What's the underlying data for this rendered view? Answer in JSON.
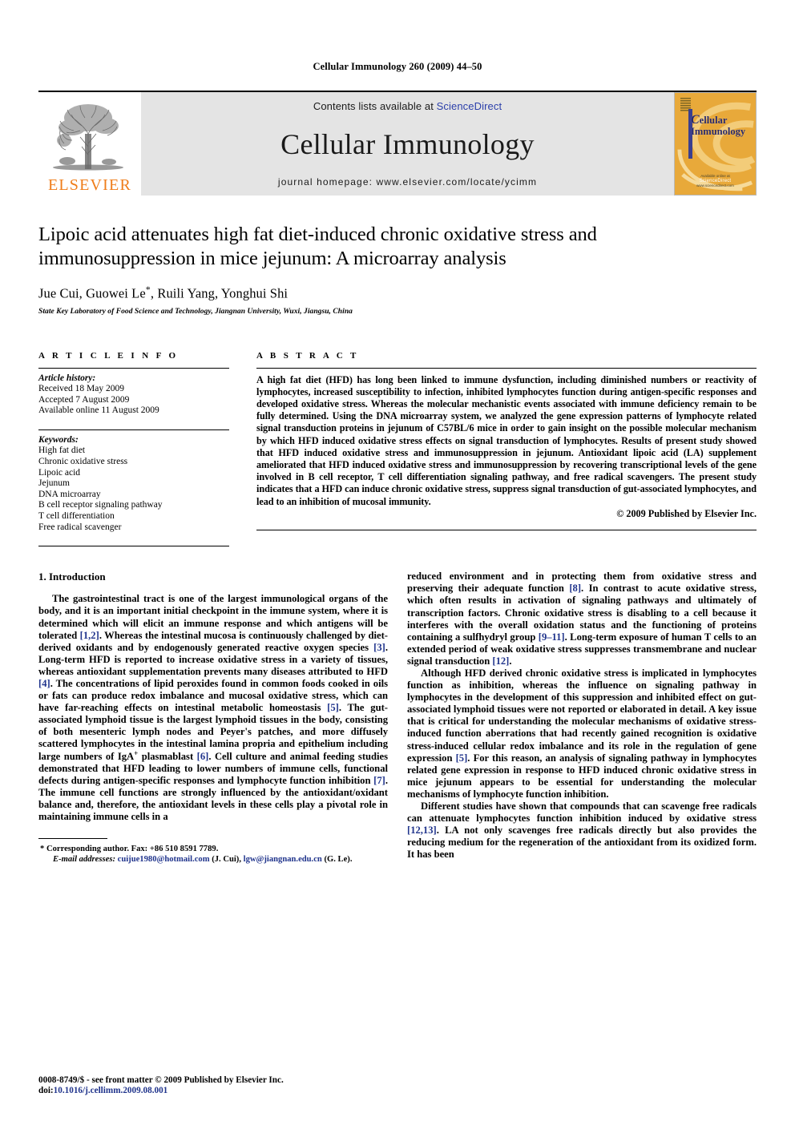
{
  "running_head": "Cellular Immunology 260 (2009) 44–50",
  "masthead": {
    "publisher_name": "ELSEVIER",
    "contents_prefix": "Contents lists available at ",
    "contents_link": "ScienceDirect",
    "journal_title": "Cellular Immunology",
    "homepage_line": "journal homepage: www.elsevier.com/locate/ycimm",
    "cover": {
      "title_first": "C",
      "title_rest_line1": "ellular",
      "title_line2": "Immunology",
      "footer_line1": "Available online at",
      "footer_brand": "ScienceDirect",
      "footer_line2": "www.sciencedirect.com"
    }
  },
  "article": {
    "title": "Lipoic acid attenuates high fat diet-induced chronic oxidative stress and immunosuppression in mice jejunum: A microarray analysis",
    "authors": "Jue Cui, Guowei Le",
    "authors_rest": ", Ruili Yang, Yonghui Shi",
    "corresponding_marker": "*",
    "affiliation": "State Key Laboratory of Food Science and Technology, Jiangnan University, Wuxi, Jiangsu, China"
  },
  "article_info": {
    "heading": "A R T I C L E     I N F O",
    "history_label": "Article history:",
    "history": [
      "Received 18 May 2009",
      "Accepted 7 August 2009",
      "Available online 11 August 2009"
    ],
    "keywords_label": "Keywords:",
    "keywords": [
      "High fat diet",
      "Chronic oxidative stress",
      "Lipoic acid",
      "Jejunum",
      "DNA microarray",
      "B cell receptor signaling pathway",
      "T cell differentiation",
      "Free radical scavenger"
    ]
  },
  "abstract": {
    "heading": "A B S T R A C T",
    "text": "A high fat diet (HFD) has long been linked to immune dysfunction, including diminished numbers or reactivity of lymphocytes, increased susceptibility to infection, inhibited lymphocytes function during antigen-specific responses and developed oxidative stress. Whereas the molecular mechanistic events associated with immune deficiency remain to be fully determined. Using the DNA microarray system, we analyzed the gene expression patterns of lymphocyte related signal transduction proteins in jejunum of C57BL/6 mice in order to gain insight on the possible molecular mechanism by which HFD induced oxidative stress effects on signal transduction of lymphocytes. Results of present study showed that HFD induced oxidative stress and immunosuppression in jejunum. Antioxidant lipoic acid (LA) supplement ameliorated that HFD induced oxidative stress and immunosuppression by recovering transcriptional levels of the gene involved in B cell receptor, T cell differentiation signaling pathway, and free radical scavengers. The present study indicates that a HFD can induce chronic oxidative stress, suppress signal transduction of gut-associated lymphocytes, and lead to an inhibition of mucosal immunity.",
    "copyright": "© 2009 Published by Elsevier Inc."
  },
  "introduction": {
    "heading": "1. Introduction",
    "left_paragraph_1_a": "The gastrointestinal tract is one of the largest immunological organs of the body, and it is an important initial checkpoint in the immune system, where it is determined which will elicit an immune response and which antigens will be tolerated ",
    "ref_1_2": "[1,2]",
    "left_paragraph_1_b": ". Whereas the intestinal mucosa is continuously challenged by diet-derived oxidants and by endogenously generated reactive oxygen species ",
    "ref_3": "[3]",
    "left_paragraph_1_c": ". Long-term HFD is reported to increase oxidative stress in a variety of tissues, whereas antioxidant supplementation prevents many diseases attributed to HFD ",
    "ref_4": "[4]",
    "left_paragraph_1_d": ". The concentrations of lipid peroxides found in common foods cooked in oils or fats can produce redox imbalance and mucosal oxidative stress, which can have far-reaching effects on intestinal metabolic homeostasis ",
    "ref_5": "[5]",
    "left_paragraph_1_e": ". The gut-associated lymphoid tissue is the largest lymphoid tissues in the body, consisting of both mesenteric lymph nodes and Peyer's patches, and more diffusely scattered lymphocytes in the intestinal lamina propria and epithelium including large numbers of IgA",
    "sup_plus": "+",
    "left_paragraph_1_f": " plasmablast ",
    "ref_6": "[6]",
    "left_paragraph_1_g": ". Cell culture and animal feeding studies demonstrated that HFD leading to lower numbers of immune cells, functional defects during antigen-specific responses and lymphocyte function inhibition ",
    "ref_7": "[7]",
    "left_paragraph_1_h": ". The immune cell functions are strongly influenced by the antioxidant/oxidant balance and, therefore, the antioxidant levels in these cells play a pivotal role in maintaining immune cells in a",
    "right_paragraph_1_a": "reduced environment and in protecting them from oxidative stress and preserving their adequate function ",
    "ref_8": "[8]",
    "right_paragraph_1_b": ". In contrast to acute oxidative stress, which often results in activation of signaling pathways and ultimately of transcription factors. Chronic oxidative stress is disabling to a cell because it interferes with the overall oxidation status and the functioning of proteins containing a sulfhydryl group ",
    "ref_9_11": "[9–11]",
    "right_paragraph_1_c": ". Long-term exposure of human T cells to an extended period of weak oxidative stress suppresses transmembrane and nuclear signal transduction ",
    "ref_12": "[12]",
    "right_paragraph_1_d": ".",
    "right_paragraph_2_a": "Although HFD derived chronic oxidative stress is implicated in lymphocytes function as inhibition, whereas the influence on signaling pathway in lymphocytes in the development of this suppression and inhibited effect on gut-associated lymphoid tissues were not reported or elaborated in detail. A key issue that is critical for understanding the molecular mechanisms of oxidative stress-induced function aberrations that had recently gained recognition is oxidative stress-induced cellular redox imbalance and its role in the regulation of gene expression ",
    "ref_5b": "[5]",
    "right_paragraph_2_b": ". For this reason, an analysis of signaling pathway in lymphocytes related gene expression in response to HFD induced chronic oxidative stress in mice jejunum appears to be essential for understanding the molecular mechanisms of lymphocyte function inhibition.",
    "right_paragraph_3_a": "Different studies have shown that compounds that can scavenge free radicals can attenuate lymphocytes function inhibition induced by oxidative stress ",
    "ref_12_13": "[12,13]",
    "right_paragraph_3_b": ". LA not only scavenges free radicals directly but also provides the reducing medium for the regeneration of the antioxidant from its oxidized form. It has been"
  },
  "footnote": {
    "marker": "*",
    "corresponding": " Corresponding author. Fax: +86 510 8591 7789.",
    "email_label": "E-mail addresses:",
    "email_1": "cuijue1980@hotmail.com",
    "email_1_attr": " (J. Cui), ",
    "email_2": "lgw@jiangnan.edu.cn",
    "email_2_attr": " (G. Le)."
  },
  "bottom_matter": {
    "front_matter": "0008-8749/$ - see front matter © 2009 Published by Elsevier Inc.",
    "doi_label": "doi:",
    "doi_value": "10.1016/j.cellimm.2009.08.001"
  },
  "colors": {
    "link_blue": "#20348c",
    "sciencedirect_blue": "#2b3faa",
    "elsevier_orange": "#ef7d1a",
    "masthead_grey": "#e4e4e4",
    "cover_gold": "#e8a93a"
  }
}
